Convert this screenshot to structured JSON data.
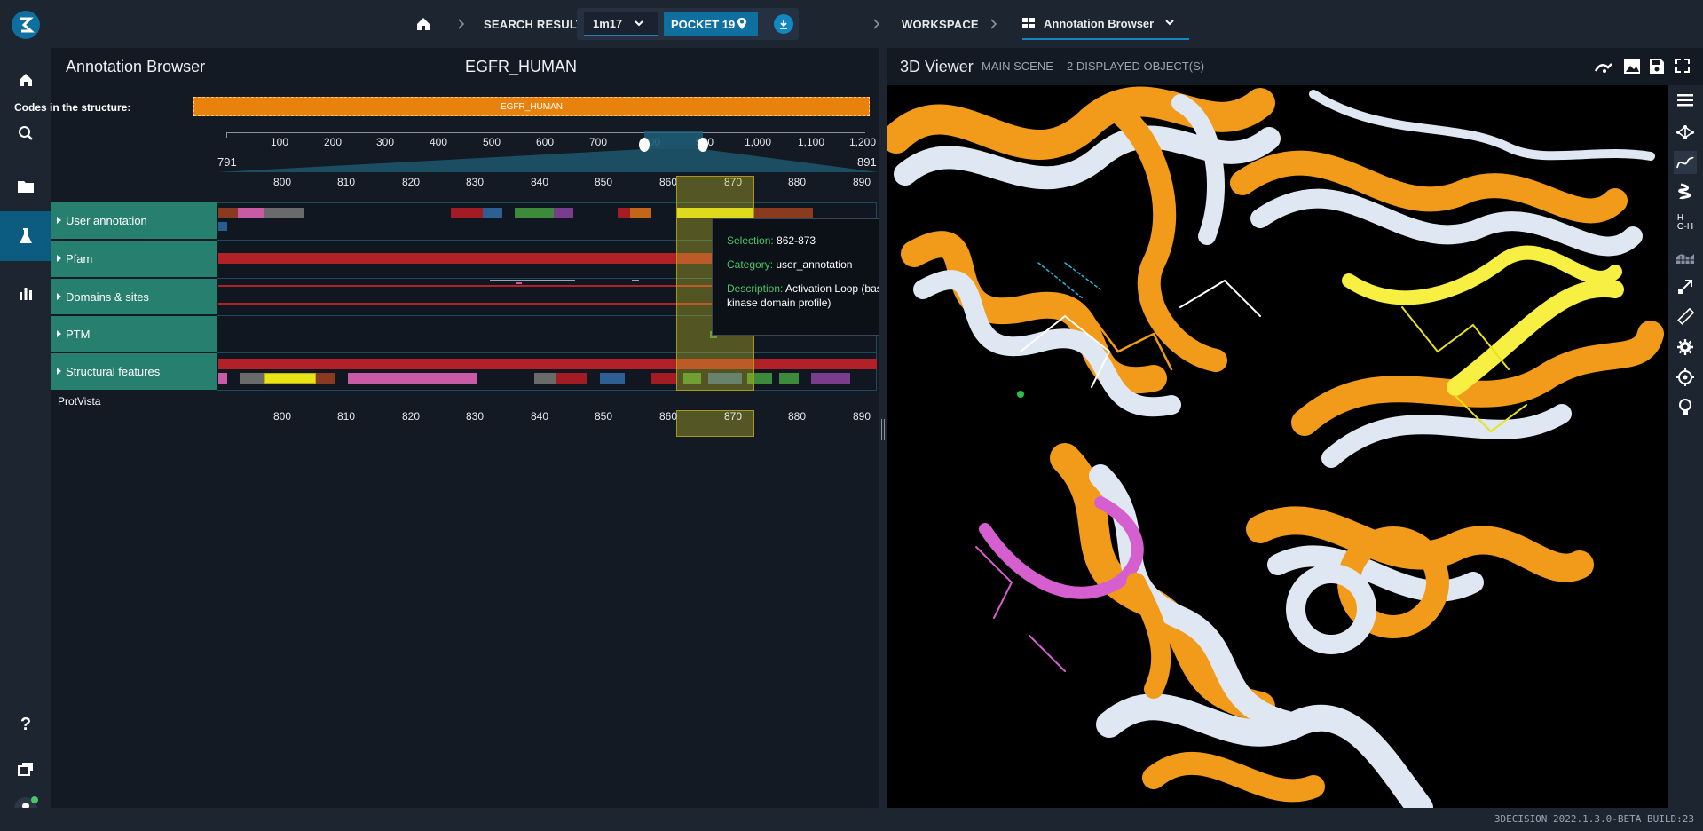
{
  "nav": {
    "items": [
      {
        "name": "home-icon"
      },
      {
        "name": "search-icon"
      },
      {
        "name": "folder-icon"
      },
      {
        "name": "flask-icon"
      },
      {
        "name": "bar-chart-icon"
      }
    ],
    "bottom": [
      {
        "name": "help-icon"
      },
      {
        "name": "copy-icon"
      },
      {
        "name": "user-icon"
      }
    ]
  },
  "breadcrumb": {
    "search_results": "SEARCH RESULTS",
    "structure": "1m17",
    "pocket": "POCKET 19",
    "workspace": "WORKSPACE",
    "current_tab": "Annotation Browser"
  },
  "annotation": {
    "title": "Annotation Browser",
    "protein": "EGFR_HUMAN",
    "codes_label": "Codes in the structure:",
    "codes_bar_text": "EGFR_HUMAN",
    "overview_ticks": [
      "100",
      "200",
      "300",
      "400",
      "500",
      "600",
      "700",
      "800",
      "900",
      "1,000",
      "1,100",
      "1,200"
    ],
    "range_start": "791",
    "range_end": "891",
    "zoom_ticks": [
      "800",
      "810",
      "820",
      "830",
      "840",
      "850",
      "860",
      "870",
      "880",
      "890"
    ],
    "tracks": [
      "User annotation",
      "Pfam",
      "Domains & sites",
      "PTM",
      "Structural features"
    ],
    "protvista_label": "ProtVista",
    "selection_highlight_range": [
      862,
      873
    ]
  },
  "tooltip": {
    "selection_key": "Selection:",
    "selection_val": "862-873",
    "category_key": "Category:",
    "category_val": "user_annotation",
    "description_key": "Description:",
    "description_val": "Activation Loop (based on Protein kinase domain profile)"
  },
  "viewer": {
    "title": "3D Viewer",
    "scene": "MAIN SCENE",
    "objects": "2 DISPLAYED OBJECT(S)",
    "head_tools": [
      "shape-icon",
      "image-icon",
      "save-icon",
      "fullscreen-icon"
    ],
    "side_tools": [
      "menu-icon",
      "network-icon",
      "curve-icon",
      "helix-icon",
      "hydrogen-icon",
      "surface-icon",
      "arrow-icon",
      "ruler-icon",
      "settings-icon",
      "target-icon",
      "lightbulb-icon"
    ]
  },
  "colors": {
    "accent": "#1387c2",
    "track_label": "#27806f",
    "orange": "#e8820c",
    "red": "#b32128",
    "yellow": "#e8e317"
  },
  "footer": {
    "build": "3DECISION 2022.1.3.0-BETA BUILD:23"
  }
}
